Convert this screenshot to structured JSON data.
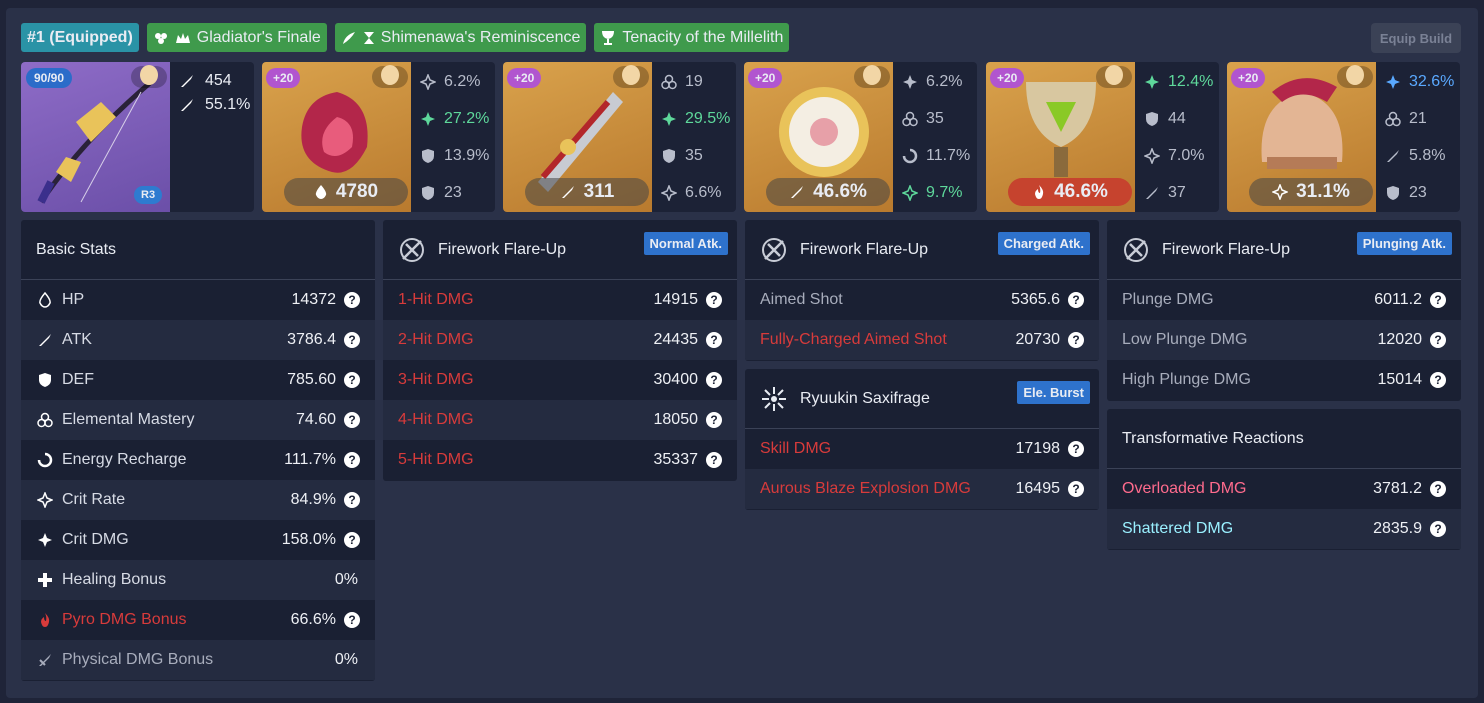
{
  "header": {
    "build_tag": "#1 (Equipped)",
    "sets": [
      "Gladiator's Finale",
      "Shimenawa's Reminiscence",
      "Tenacity of the Millelith"
    ],
    "equip_button": "Equip Build"
  },
  "weapon": {
    "level": "90/90",
    "refine": "R3",
    "atk": "454",
    "sub": "55.1%"
  },
  "artifacts": [
    {
      "level": "+20",
      "main": "4780",
      "subs": [
        "6.2%",
        "27.2%",
        "13.9%",
        "23"
      ]
    },
    {
      "level": "+20",
      "main": "311",
      "subs": [
        "19",
        "29.5%",
        "35",
        "6.6%"
      ]
    },
    {
      "level": "+20",
      "main": "46.6%",
      "subs": [
        "6.2%",
        "35",
        "11.7%",
        "9.7%"
      ]
    },
    {
      "level": "+20",
      "main": "46.6%",
      "subs": [
        "12.4%",
        "44",
        "7.0%",
        "37"
      ]
    },
    {
      "level": "+20",
      "main": "31.1%",
      "subs": [
        "32.6%",
        "21",
        "5.8%",
        "23"
      ]
    }
  ],
  "basic_stats": {
    "title": "Basic Stats",
    "rows": [
      {
        "label": "HP",
        "value": "14372",
        "icon": "hp-icon"
      },
      {
        "label": "ATK",
        "value": "3786.4",
        "icon": "atk-icon"
      },
      {
        "label": "DEF",
        "value": "785.60",
        "icon": "def-icon"
      },
      {
        "label": "Elemental Mastery",
        "value": "74.60",
        "icon": "em-icon"
      },
      {
        "label": "Energy Recharge",
        "value": "111.7%",
        "icon": "er-icon"
      },
      {
        "label": "Crit Rate",
        "value": "84.9%",
        "icon": "crit-rate-icon"
      },
      {
        "label": "Crit DMG",
        "value": "158.0%",
        "icon": "crit-dmg-icon"
      },
      {
        "label": "Healing Bonus",
        "value": "0%",
        "icon": "healing-icon"
      },
      {
        "label": "Pyro DMG Bonus",
        "value": "66.6%",
        "icon": "pyro-icon"
      },
      {
        "label": "Physical DMG Bonus",
        "value": "0%",
        "icon": "physical-icon"
      }
    ]
  },
  "normal": {
    "title": "Firework Flare-Up",
    "badge": "Normal Atk.",
    "rows": [
      {
        "label": "1-Hit DMG",
        "value": "14915"
      },
      {
        "label": "2-Hit DMG",
        "value": "24435"
      },
      {
        "label": "3-Hit DMG",
        "value": "30400"
      },
      {
        "label": "4-Hit DMG",
        "value": "18050"
      },
      {
        "label": "5-Hit DMG",
        "value": "35337"
      }
    ]
  },
  "charged": {
    "title": "Firework Flare-Up",
    "badge": "Charged Atk.",
    "rows": [
      {
        "label": "Aimed Shot",
        "value": "5365.6"
      },
      {
        "label": "Fully-Charged Aimed Shot",
        "value": "20730"
      }
    ]
  },
  "burst": {
    "title": "Ryuukin Saxifrage",
    "badge": "Ele. Burst",
    "rows": [
      {
        "label": "Skill DMG",
        "value": "17198"
      },
      {
        "label": "Aurous Blaze Explosion DMG",
        "value": "16495"
      }
    ]
  },
  "plunging": {
    "title": "Firework Flare-Up",
    "badge": "Plunging Atk.",
    "rows": [
      {
        "label": "Plunge DMG",
        "value": "6011.2"
      },
      {
        "label": "Low Plunge DMG",
        "value": "12020"
      },
      {
        "label": "High Plunge DMG",
        "value": "15014"
      }
    ]
  },
  "transformative": {
    "title": "Transformative Reactions",
    "rows": [
      {
        "label": "Overloaded DMG",
        "value": "3781.2"
      },
      {
        "label": "Shattered DMG",
        "value": "2835.9"
      }
    ]
  },
  "colors": {
    "pyro": "#d83b3b",
    "accent_green": "#5ed89b",
    "badge_blue": "#2e72cc",
    "set_green": "#3f9a4c"
  }
}
